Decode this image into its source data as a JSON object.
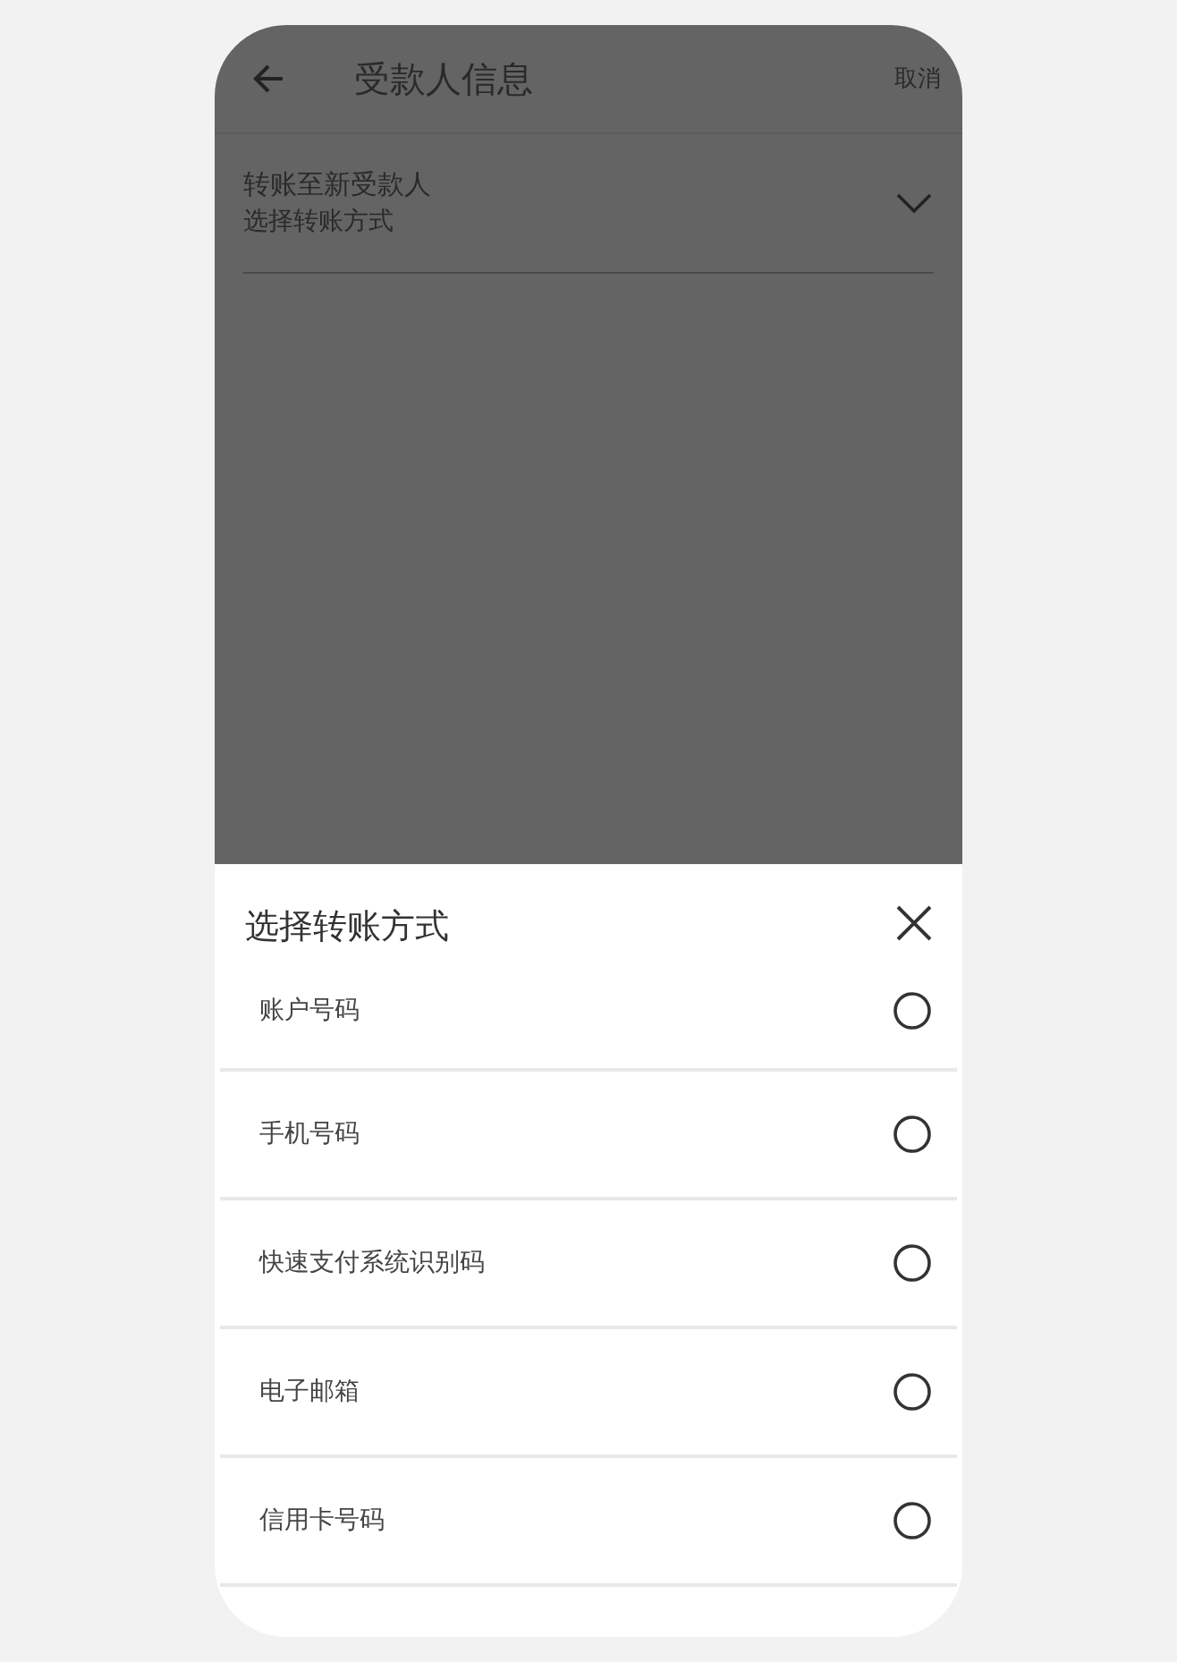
{
  "header": {
    "title": "受款人信息",
    "cancel": "取消"
  },
  "transfer": {
    "title": "转账至新受款人",
    "subtitle": "选择转账方式",
    "expanded": false
  },
  "sheet": {
    "title": "选择转账方式",
    "options": [
      {
        "label": "账户号码",
        "selected": false
      },
      {
        "label": "手机号码",
        "selected": false
      },
      {
        "label": "快速支付系统识别码",
        "selected": false
      },
      {
        "label": "电子邮箱",
        "selected": false
      },
      {
        "label": "信用卡号码",
        "selected": false
      }
    ]
  }
}
